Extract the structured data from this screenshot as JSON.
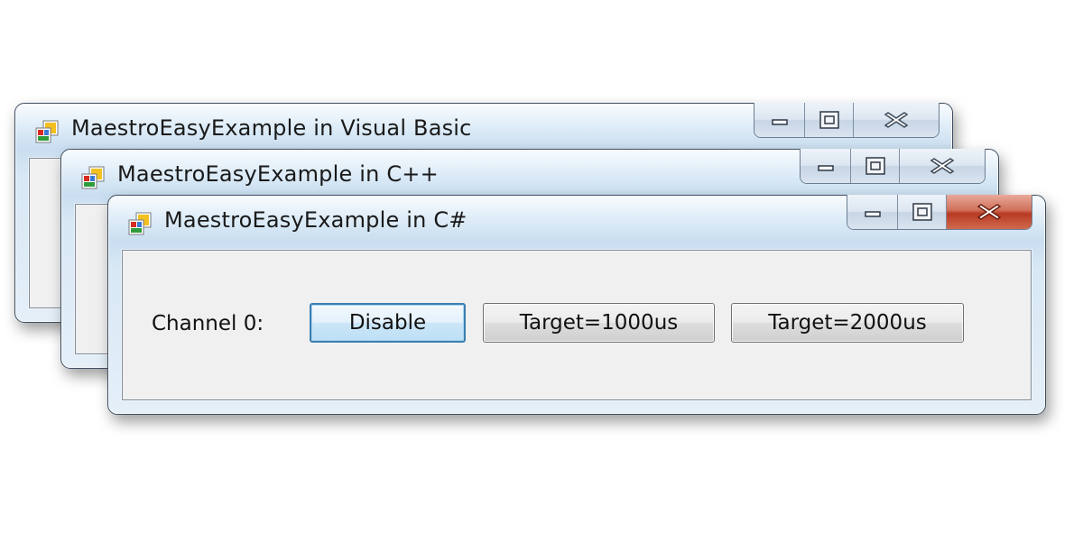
{
  "windows": [
    {
      "title": "MaestroEasyExample in Visual Basic",
      "icon": "winforms-app-icon",
      "active": false
    },
    {
      "title": "MaestroEasyExample in C++",
      "icon": "winforms-app-icon",
      "active": false
    },
    {
      "title": "MaestroEasyExample in C#",
      "icon": "winforms-app-icon",
      "active": true,
      "channel_label": "Channel 0:",
      "buttons": {
        "disable": "Disable",
        "target_1000": "Target=1000us",
        "target_2000": "Target=2000us"
      }
    }
  ],
  "colors": {
    "close_active": "#c7452c",
    "focus_border": "#3c7fb1",
    "client_bg": "#f0f0f0"
  }
}
